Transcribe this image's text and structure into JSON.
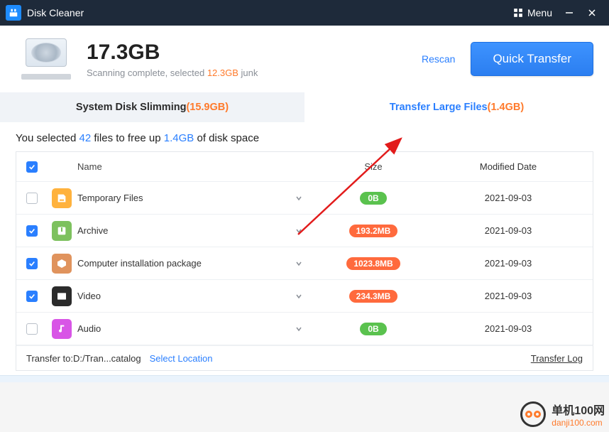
{
  "app_title": "Disk Cleaner",
  "menu_label": "Menu",
  "summary": {
    "total": "17.3GB",
    "status_prefix": "Scanning complete, selected ",
    "status_selected": "12.3GB",
    "status_suffix": " junk",
    "rescan": "Rescan",
    "quick_transfer": "Quick Transfer"
  },
  "tabs": {
    "tab1_label": "System Disk Slimming ",
    "tab1_paren": "(15.9GB)",
    "tab2_label": "Transfer Large Files ",
    "tab2_paren": "(1.4GB)"
  },
  "selection": {
    "p1": "You selected ",
    "count": "42",
    "p2": " files to free up ",
    "size": "1.4GB",
    "p3": "  of disk space"
  },
  "columns": {
    "name": "Name",
    "size": "Size",
    "date": "Modified Date"
  },
  "rows": [
    {
      "checked": false,
      "icon": "ci-temp",
      "name": "Temporary Files",
      "size": "0B",
      "pill": "pill-green",
      "date": "2021-09-03"
    },
    {
      "checked": true,
      "icon": "ci-archive",
      "name": "Archive",
      "size": "193.2MB",
      "pill": "pill-orange",
      "date": "2021-09-03"
    },
    {
      "checked": true,
      "icon": "ci-pkg",
      "name": "Computer installation package",
      "size": "1023.8MB",
      "pill": "pill-orange",
      "date": "2021-09-03"
    },
    {
      "checked": true,
      "icon": "ci-video",
      "name": "Video",
      "size": "234.3MB",
      "pill": "pill-orange",
      "date": "2021-09-03"
    },
    {
      "checked": false,
      "icon": "ci-audio",
      "name": "Audio",
      "size": "0B",
      "pill": "pill-green",
      "date": "2021-09-03"
    }
  ],
  "footer": {
    "prefix": "Transfer to: ",
    "path": "D:/Tran...catalog",
    "select": "Select Location",
    "log": "Transfer Log"
  },
  "watermark": {
    "cn": "单机100网",
    "domain": "danji100.com"
  }
}
